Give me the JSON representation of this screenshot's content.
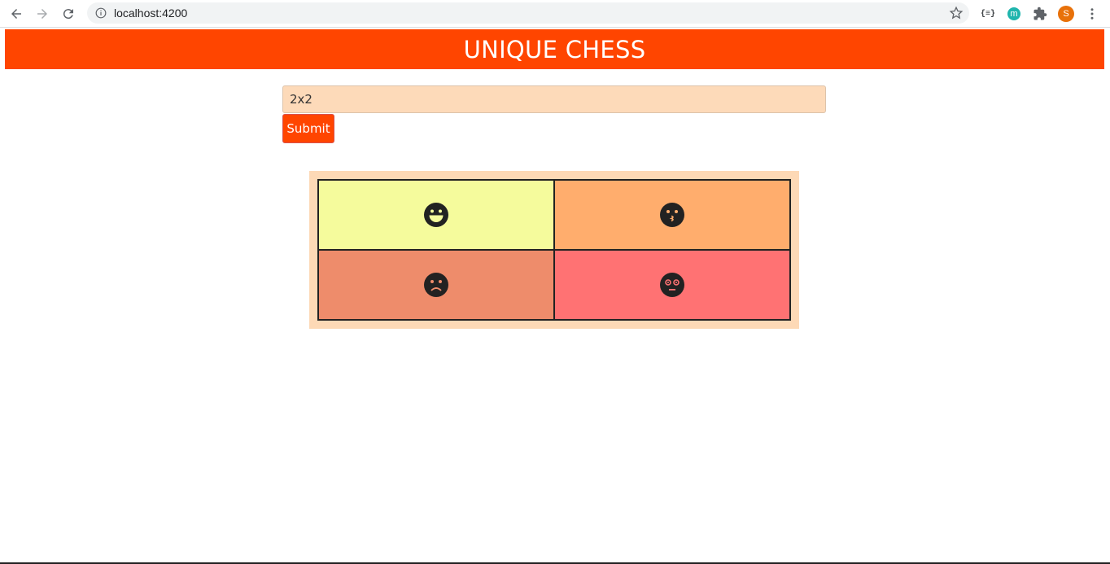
{
  "browser": {
    "url": "localhost:4200",
    "extension_label": "{≡}",
    "extension_m": "m",
    "profile_initial": "S"
  },
  "header": {
    "title": "UNIQUE CHESS"
  },
  "form": {
    "input_value": "2x2",
    "submit_label": "Submit"
  },
  "board": {
    "rows": 2,
    "cols": 2,
    "cells": [
      {
        "color": "#f5fb9c",
        "icon": "grinning-face-icon"
      },
      {
        "color": "#ffad6d",
        "icon": "kissing-face-icon"
      },
      {
        "color": "#ee8c6b",
        "icon": "frowning-face-icon"
      },
      {
        "color": "#ff7273",
        "icon": "dizzy-face-icon"
      }
    ]
  },
  "colors": {
    "accent": "#ff4500",
    "board_bg": "#fdd9b6",
    "input_bg": "#fddab9"
  }
}
